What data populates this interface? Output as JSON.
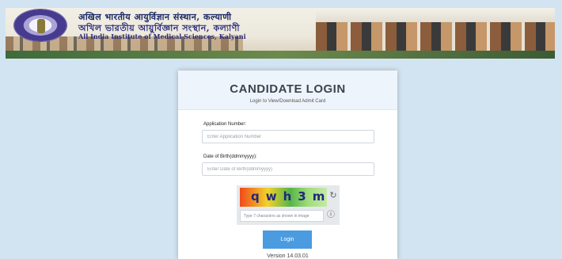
{
  "banner": {
    "hindi_line1": "अखिल भारतीय आयुर्विज्ञान संस्थान, कल्याणी",
    "bengali_line2": "অখিল ভারতীয় আয়ুর্বিজ্ঞান সংস্থান, কল্যাণী",
    "english_line3": "All India Institute of Medical Sciences, Kalyani",
    "logo_icon": "aiims-emblem-icon"
  },
  "login": {
    "title": "CANDIDATE LOGIN",
    "subtitle": "Login to View/Download Admit Card",
    "application_label": "Application Number:",
    "application_placeholder": "Enter Application Number",
    "application_value": "",
    "dob_label": "Date of Birth(ddmmyyyy):",
    "dob_placeholder": "Enter Date of Birth(ddmmyyyy)",
    "dob_value": "",
    "captcha_text": "qwh3m",
    "captcha_refresh_icon": "refresh-icon",
    "captcha_placeholder": "Type 7 characters as shown in image",
    "captcha_help_icon": "help-icon",
    "button_label": "Login",
    "version": "Version 14.03.01"
  },
  "colors": {
    "page_bg": "#d2e4f1",
    "button_bg": "#4a9be0",
    "card_header_bg": "#eef4fb"
  }
}
